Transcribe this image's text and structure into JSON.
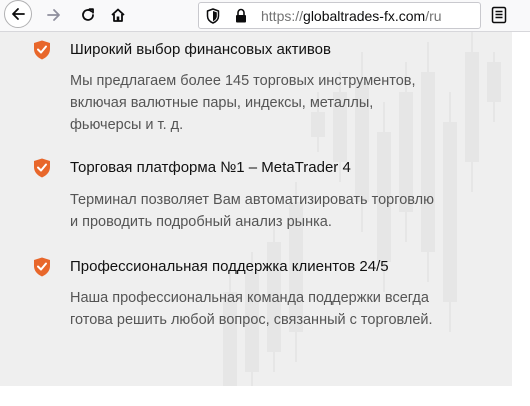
{
  "browser": {
    "url_host": "globaltrades-fx.com",
    "url_scheme": "https://",
    "url_path": "/ru"
  },
  "features": [
    {
      "title": "Широкий выбор финансовых активов",
      "lines": [
        "Мы предлагаем более 145 торговых инструментов,",
        "включая валютные пары, индексы, металлы,",
        "фьючерсы и т. д."
      ]
    },
    {
      "title": "Торговая платформа №1 – MetaTrader 4",
      "lines": [
        "Терминал позволяет Вам автоматизировать торговлю",
        "и проводить подробный анализ рынка."
      ]
    },
    {
      "title": "Профессиональная поддержка клиентов 24/5",
      "lines": [
        "Наша профессиональная команда поддержки всегда",
        "готова решить любой вопрос, связанный с торговлей."
      ]
    }
  ],
  "colors": {
    "accent": "#e8672b",
    "content_bg": "#efefef",
    "candle": "#e6e6e6"
  }
}
